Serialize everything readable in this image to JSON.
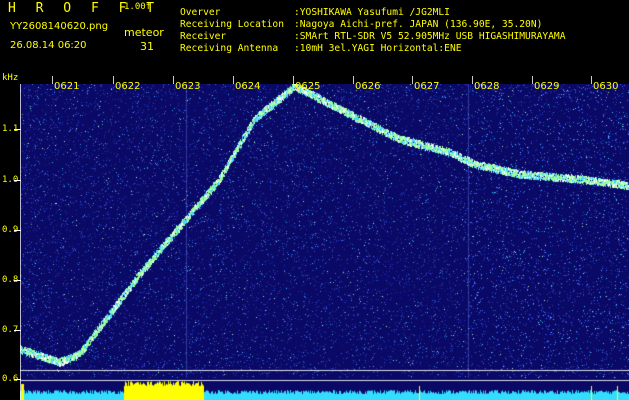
{
  "header": {
    "brand": "H R O F F T",
    "version": "1.00f",
    "filename": "YY2608140620.png",
    "meteor_label": "meteor",
    "datetime": "26.08.14 06:20",
    "meteor_count": "31"
  },
  "info": [
    {
      "key": "Overver",
      "value": ":YOSHIKAWA Yasufumi /JG2MLI"
    },
    {
      "key": "Receiving Location",
      "value": ":Nagoya Aichi-pref. JAPAN (136.90E, 35.20N)"
    },
    {
      "key": "Receiver",
      "value": ":SMArt RTL-SDR V5 52.905MHz USB HIGASHIMURAYAMA"
    },
    {
      "key": "Receiving Antenna",
      "value": ":10mH 3el.YAGI Horizontal:ENE"
    }
  ],
  "axis": {
    "unit": "kHz",
    "freq_labels": [
      "1.1",
      "1.0",
      "0.9",
      "0.8",
      "0.7",
      "0.6"
    ],
    "time_labels": [
      "0621",
      "0622",
      "0623",
      "0624",
      "0625",
      "0626",
      "0627",
      "0628",
      "0629",
      "0630"
    ]
  },
  "colors": {
    "label": "#ffff00",
    "background": "#000000",
    "waterfall_bg": "#0a0a66",
    "trace": "#9cff9c",
    "baseline": "#33ddff"
  }
}
